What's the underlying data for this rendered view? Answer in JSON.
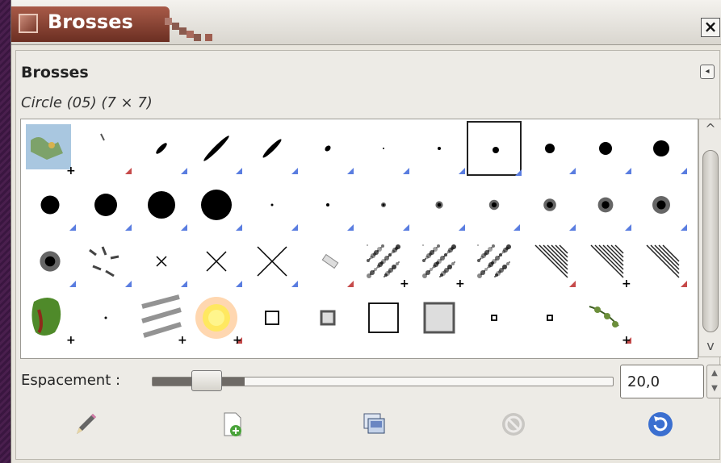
{
  "window": {
    "title": "Brosses",
    "close_label": "×"
  },
  "panel": {
    "title": "Brosses",
    "menu_icon": "◂",
    "selected_brush": "Circle (05) (7 × 7)"
  },
  "brushes": [
    {
      "kind": "map",
      "mark": "plus"
    },
    {
      "kind": "line",
      "mark": "red"
    },
    {
      "kind": "ellipse",
      "mark": "blue"
    },
    {
      "kind": "ellipse",
      "mark": "blue"
    },
    {
      "kind": "ellipse",
      "mark": "blue"
    },
    {
      "kind": "ellipse",
      "mark": "blue"
    },
    {
      "kind": "dot",
      "mark": "blue"
    },
    {
      "kind": "dot",
      "mark": "blue"
    },
    {
      "kind": "dot",
      "mark": "blue",
      "selected": true
    },
    {
      "kind": "dot",
      "mark": "blue"
    },
    {
      "kind": "dot",
      "mark": "blue"
    },
    {
      "kind": "dot",
      "mark": "blue"
    },
    {
      "kind": "dot",
      "mark": "blue"
    },
    {
      "kind": "dot",
      "mark": "blue"
    },
    {
      "kind": "dot",
      "mark": "blue"
    },
    {
      "kind": "dot",
      "mark": "blue"
    },
    {
      "kind": "dot",
      "mark": "blue"
    },
    {
      "kind": "dot",
      "mark": "blue"
    },
    {
      "kind": "fuzzy",
      "mark": "blue"
    },
    {
      "kind": "fuzzy",
      "mark": "blue"
    },
    {
      "kind": "fuzzy",
      "mark": "blue"
    },
    {
      "kind": "fuzzy",
      "mark": "blue"
    },
    {
      "kind": "fuzzy",
      "mark": "blue"
    },
    {
      "kind": "fuzzy",
      "mark": "blue"
    },
    {
      "kind": "fuzzy",
      "mark": "blue"
    },
    {
      "kind": "strokes",
      "mark": "blue"
    },
    {
      "kind": "cross",
      "mark": "blue"
    },
    {
      "kind": "cross",
      "mark": "blue"
    },
    {
      "kind": "cross",
      "mark": "blue"
    },
    {
      "kind": "pencil",
      "mark": "red"
    },
    {
      "kind": "splatter",
      "mark": "plus"
    },
    {
      "kind": "splatter",
      "mark": "plus"
    },
    {
      "kind": "splatter",
      "mark": "none"
    },
    {
      "kind": "hatch",
      "mark": "red"
    },
    {
      "kind": "hatch",
      "mark": "plus"
    },
    {
      "kind": "hatch",
      "mark": "red"
    },
    {
      "kind": "pepper",
      "mark": "plus"
    },
    {
      "kind": "dot",
      "mark": "none"
    },
    {
      "kind": "texture",
      "mark": "plus"
    },
    {
      "kind": "sun",
      "mark": "red-plus"
    },
    {
      "kind": "square",
      "mark": "none"
    },
    {
      "kind": "square-fuzzy",
      "mark": "none"
    },
    {
      "kind": "square",
      "mark": "none"
    },
    {
      "kind": "square-fuzzy",
      "mark": "none"
    },
    {
      "kind": "square",
      "mark": "none"
    },
    {
      "kind": "square",
      "mark": "none"
    },
    {
      "kind": "vine",
      "mark": "red-plus"
    }
  ],
  "spacing": {
    "label": "Espacement :",
    "value": "20,0",
    "slider_fraction": 0.2
  },
  "toolbar": [
    {
      "name": "edit-brush-button",
      "icon": "pencil-icon",
      "enabled": true
    },
    {
      "name": "new-brush-button",
      "icon": "new-document-icon",
      "enabled": true
    },
    {
      "name": "duplicate-brush-button",
      "icon": "duplicate-icon",
      "enabled": true
    },
    {
      "name": "delete-brush-button",
      "icon": "delete-icon",
      "enabled": false
    },
    {
      "name": "refresh-brushes-button",
      "icon": "refresh-icon",
      "enabled": true
    }
  ],
  "colors": {
    "accent_red": "#b5453a",
    "accent_blue": "#5a7de0"
  }
}
